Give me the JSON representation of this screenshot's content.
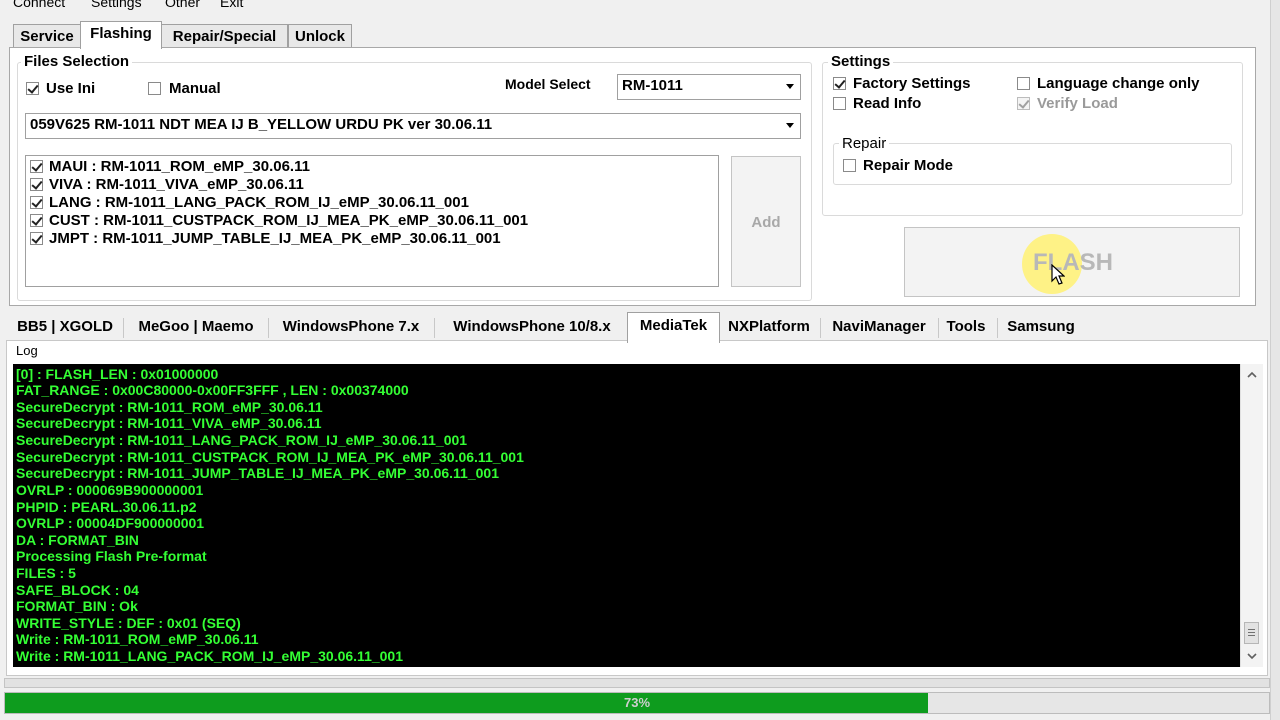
{
  "menu": {
    "items": [
      "Connect",
      "Settings",
      "Other",
      "Exit"
    ]
  },
  "top_tabs": [
    {
      "label": "Service",
      "active": false
    },
    {
      "label": "Flashing",
      "active": true
    },
    {
      "label": "Repair/Special",
      "active": false
    },
    {
      "label": "Unlock",
      "active": false
    }
  ],
  "files_selection": {
    "title": "Files Selection",
    "use_ini_label": "Use Ini",
    "use_ini_checked": true,
    "manual_label": "Manual",
    "manual_checked": false,
    "model_select_label": "Model Select",
    "model_value": "RM-1011",
    "firmware_value": "059V625 RM-1011 NDT MEA IJ B_YELLOW URDU PK ver 30.06.11",
    "files": [
      {
        "text": "MAUI : RM-1011_ROM_eMP_30.06.11",
        "checked": true
      },
      {
        "text": "VIVA : RM-1011_VIVA_eMP_30.06.11",
        "checked": true
      },
      {
        "text": "LANG : RM-1011_LANG_PACK_ROM_IJ_eMP_30.06.11_001",
        "checked": true
      },
      {
        "text": "CUST : RM-1011_CUSTPACK_ROM_IJ_MEA_PK_eMP_30.06.11_001",
        "checked": true
      },
      {
        "text": "JMPT : RM-1011_JUMP_TABLE_IJ_MEA_PK_eMP_30.06.11_001",
        "checked": true
      }
    ],
    "add_label": "Add"
  },
  "settings": {
    "title": "Settings",
    "factory_settings_label": "Factory Settings",
    "factory_settings_checked": true,
    "read_info_label": "Read Info",
    "read_info_checked": false,
    "language_change_label": "Language change only",
    "language_change_checked": false,
    "verify_load_label": "Verify Load",
    "verify_load_checked": true,
    "repair_title": "Repair",
    "repair_mode_label": "Repair Mode",
    "repair_mode_checked": false
  },
  "flash_button_label": "FLASH",
  "platform_tabs": [
    {
      "label": "BB5 | XGOLD",
      "active": false
    },
    {
      "label": "MeGoo | Maemo",
      "active": false
    },
    {
      "label": "WindowsPhone 7.x",
      "active": false
    },
    {
      "label": "WindowsPhone 10/8.x",
      "active": false
    },
    {
      "label": "MediaTek",
      "active": true
    },
    {
      "label": "NXPlatform",
      "active": false
    },
    {
      "label": "NaviManager",
      "active": false
    },
    {
      "label": "Tools",
      "active": false
    },
    {
      "label": "Samsung",
      "active": false
    }
  ],
  "log": {
    "title": "Log",
    "lines": [
      "[0] : FLASH_LEN : 0x01000000",
      "FAT_RANGE : 0x00C80000-0x00FF3FFF , LEN : 0x00374000",
      "SecureDecrypt : RM-1011_ROM_eMP_30.06.11",
      "SecureDecrypt : RM-1011_VIVA_eMP_30.06.11",
      "SecureDecrypt : RM-1011_LANG_PACK_ROM_IJ_eMP_30.06.11_001",
      "SecureDecrypt : RM-1011_CUSTPACK_ROM_IJ_MEA_PK_eMP_30.06.11_001",
      "SecureDecrypt : RM-1011_JUMP_TABLE_IJ_MEA_PK_eMP_30.06.11_001",
      "OVRLP : 000069B900000001",
      "PHPID : PEARL.30.06.11.p2",
      "OVRLP : 00004DF900000001",
      "DA : FORMAT_BIN",
      "Processing Flash Pre-format",
      "FILES : 5",
      "SAFE_BLOCK : 04",
      "FORMAT_BIN : Ok",
      "WRITE_STYLE : DEF : 0x01 (SEQ)",
      "Write : RM-1011_ROM_eMP_30.06.11",
      "Write : RM-1011_LANG_PACK_ROM_IJ_eMP_30.06.11_001"
    ]
  },
  "progress": {
    "percent": 73,
    "label": "73%"
  },
  "colors": {
    "console_bg": "#000000",
    "console_text": "#34ff34",
    "progress_fill": "#0e9c1e",
    "cursor_highlight": "#fff27a"
  }
}
